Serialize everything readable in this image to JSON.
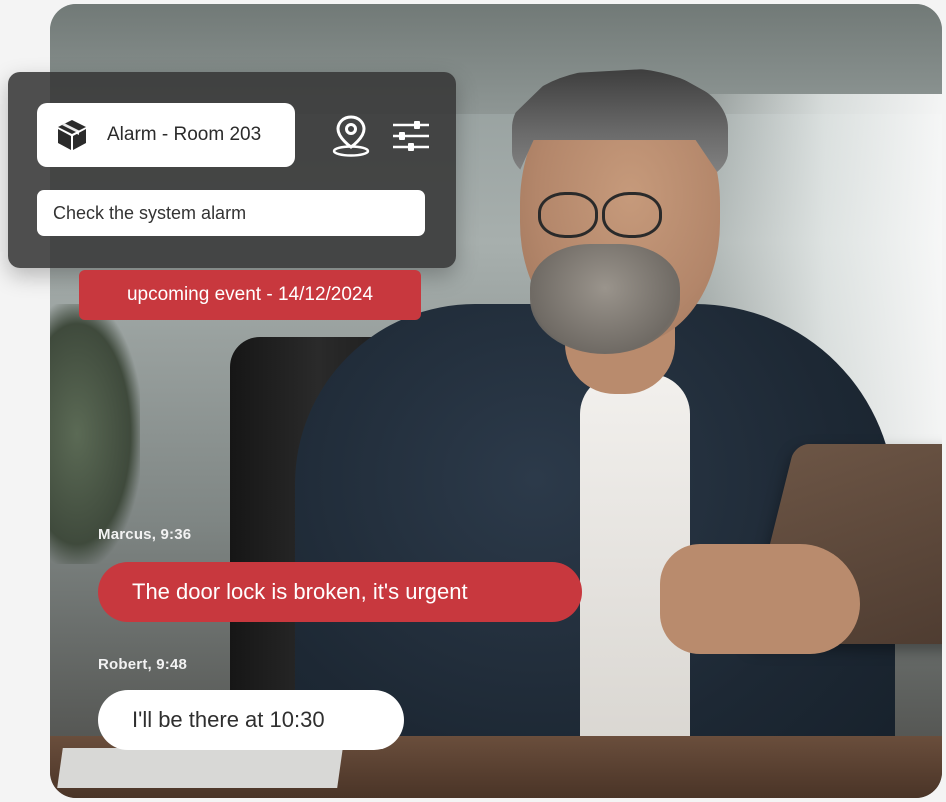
{
  "alert": {
    "title": "Alarm - Room 203",
    "task": "Check the system alarm",
    "event": "upcoming event - 14/12/2024"
  },
  "icons": {
    "category": "box-icon",
    "location": "map-pin-icon",
    "filters": "sliders-icon"
  },
  "chat": [
    {
      "sender": "Marcus, 9:36",
      "message": "The door lock is broken, it's urgent"
    },
    {
      "sender": "Robert, 9:48",
      "message": "I'll be there at 10:30"
    }
  ],
  "colors": {
    "accent": "#c8383e",
    "panel": "#373737",
    "surface": "#ffffff"
  }
}
